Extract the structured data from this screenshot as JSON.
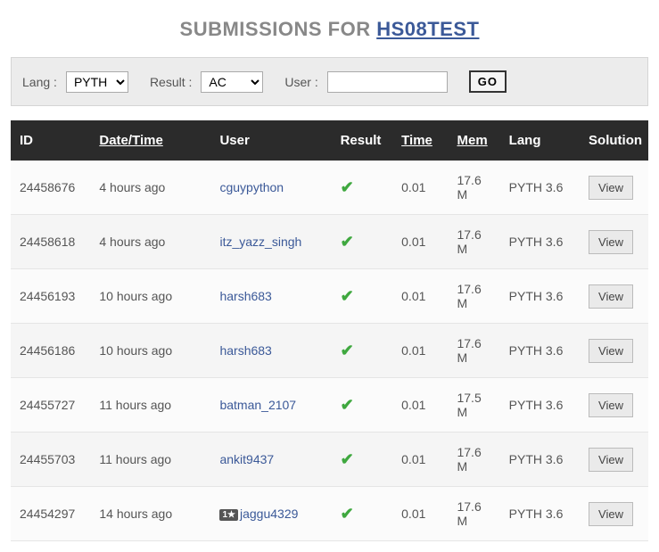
{
  "title_prefix": "SUBMISSIONS FOR ",
  "title_code": "HS08TEST",
  "filters": {
    "lang_label": "Lang :",
    "lang_value": "PYTH",
    "result_label": "Result :",
    "result_value": "AC",
    "user_label": "User :",
    "user_value": "",
    "go_label": "GO"
  },
  "headers": {
    "id": "ID",
    "datetime": "Date/Time",
    "user": "User",
    "result": "Result",
    "time": "Time",
    "mem": "Mem",
    "lang": "Lang",
    "solution": "Solution"
  },
  "view_label": "View",
  "rows": [
    {
      "id": "24458676",
      "datetime": "4 hours ago",
      "user": "cguypython",
      "badge": "",
      "time": "0.01",
      "mem": "17.6M",
      "lang": "PYTH 3.6"
    },
    {
      "id": "24458618",
      "datetime": "4 hours ago",
      "user": "itz_yazz_singh",
      "badge": "",
      "time": "0.01",
      "mem": "17.6M",
      "lang": "PYTH 3.6"
    },
    {
      "id": "24456193",
      "datetime": "10 hours ago",
      "user": "harsh683",
      "badge": "",
      "time": "0.01",
      "mem": "17.6M",
      "lang": "PYTH 3.6"
    },
    {
      "id": "24456186",
      "datetime": "10 hours ago",
      "user": "harsh683",
      "badge": "",
      "time": "0.01",
      "mem": "17.6M",
      "lang": "PYTH 3.6"
    },
    {
      "id": "24455727",
      "datetime": "11 hours ago",
      "user": "batman_2107",
      "badge": "",
      "time": "0.01",
      "mem": "17.5M",
      "lang": "PYTH 3.6"
    },
    {
      "id": "24455703",
      "datetime": "11 hours ago",
      "user": "ankit9437",
      "badge": "",
      "time": "0.01",
      "mem": "17.6M",
      "lang": "PYTH 3.6"
    },
    {
      "id": "24454297",
      "datetime": "14 hours ago",
      "user": "jaggu4329",
      "badge": "1★",
      "time": "0.01",
      "mem": "17.6M",
      "lang": "PYTH 3.6"
    }
  ]
}
